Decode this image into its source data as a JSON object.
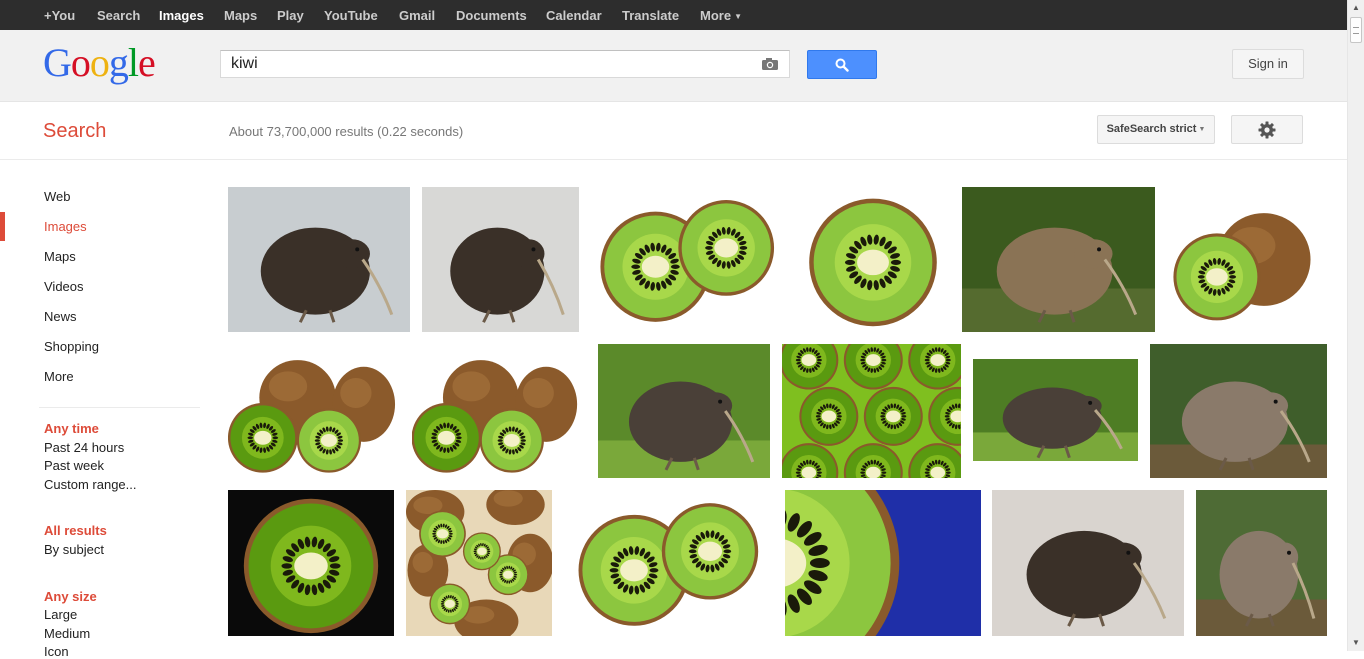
{
  "topnav": {
    "items": [
      {
        "label": "+You"
      },
      {
        "label": "Search"
      },
      {
        "label": "Images"
      },
      {
        "label": "Maps"
      },
      {
        "label": "Play"
      },
      {
        "label": "YouTube"
      },
      {
        "label": "Gmail"
      },
      {
        "label": "Documents"
      },
      {
        "label": "Calendar"
      },
      {
        "label": "Translate"
      },
      {
        "label": "More"
      }
    ],
    "active": "Images"
  },
  "header": {
    "logo_text": "Google",
    "search_value": "kiwi",
    "search_icon": "magnifier-icon",
    "camera_icon": "camera-icon",
    "signin_label": "Sign in"
  },
  "subheader": {
    "title": "Search",
    "result_stats": "About 73,700,000 results (0.22 seconds)",
    "safesearch_label": "SafeSearch strict",
    "settings_icon": "gear-icon"
  },
  "sidebar": {
    "items": [
      {
        "label": "Web"
      },
      {
        "label": "Images"
      },
      {
        "label": "Maps"
      },
      {
        "label": "Videos"
      },
      {
        "label": "News"
      },
      {
        "label": "Shopping"
      },
      {
        "label": "More"
      }
    ],
    "active": "Images",
    "time_filter": {
      "heading": "Any time",
      "options": [
        "Past 24 hours",
        "Past week",
        "Custom range..."
      ]
    },
    "results_filter": {
      "heading": "All results",
      "options": [
        "By subject"
      ]
    },
    "size_filter": {
      "heading": "Any size",
      "options": [
        "Large",
        "Medium",
        "Icon"
      ]
    }
  },
  "results": [
    {
      "subject": "kiwi bird"
    },
    {
      "subject": "kiwi chick"
    },
    {
      "subject": "kiwi fruit halves"
    },
    {
      "subject": "kiwi fruit slice"
    },
    {
      "subject": "kiwi bird foraging"
    },
    {
      "subject": "kiwi fruit cut"
    },
    {
      "subject": "kiwi fruits"
    },
    {
      "subject": "kiwi fruits"
    },
    {
      "subject": "kiwi bird in ferns"
    },
    {
      "subject": "kiwi fruit slices"
    },
    {
      "subject": "kiwi bird"
    },
    {
      "subject": "kiwi bird"
    },
    {
      "subject": "kiwi fruit backlit"
    },
    {
      "subject": "kiwi fruit pile"
    },
    {
      "subject": "kiwi fruit halves"
    },
    {
      "subject": "kiwi fruit slice blue"
    },
    {
      "subject": "kiwi bird"
    },
    {
      "subject": "kiwi bird"
    }
  ],
  "colors": {
    "accent_red": "#dd4b39",
    "search_blue": "#4d90fe",
    "topbar": "#2d2d2d"
  }
}
